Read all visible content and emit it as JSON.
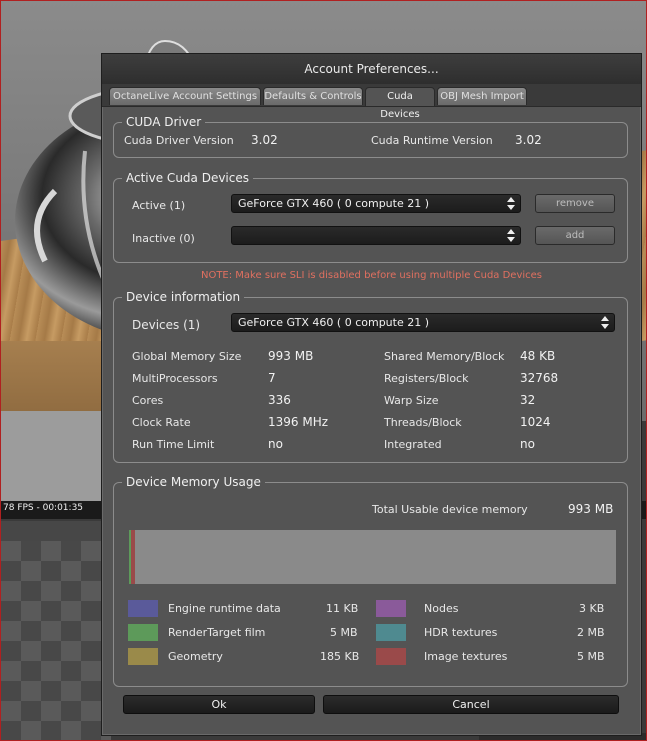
{
  "viewport": {
    "status": "78 FPS - 00:01:35"
  },
  "dialog": {
    "title": "Account Preferences...",
    "tabs": [
      {
        "label": "OctaneLive Account Settings"
      },
      {
        "label": "Defaults & Controls"
      },
      {
        "label": "Cuda Devices"
      },
      {
        "label": "OBJ Mesh Import"
      }
    ],
    "active_tab": "Cuda Devices"
  },
  "driver": {
    "legend": "CUDA Driver",
    "driver_version_label": "Cuda Driver Version",
    "driver_version": "3.02",
    "runtime_version_label": "Cuda Runtime Version",
    "runtime_version": "3.02"
  },
  "active_devices": {
    "legend": "Active Cuda Devices",
    "active_label": "Active (1)",
    "active_value": "GeForce GTX 460 ( 0 compute 21 )",
    "inactive_label": "Inactive (0)",
    "inactive_value": "",
    "remove_label": "remove",
    "add_label": "add"
  },
  "note": "NOTE: Make sure SLI is disabled before using multiple Cuda Devices",
  "device_info": {
    "legend": "Device information",
    "devices_label": "Devices (1)",
    "devices_value": "GeForce GTX 460 ( 0 compute 21 )",
    "left": [
      {
        "label": "Global Memory Size",
        "value": "993 MB"
      },
      {
        "label": "MultiProcessors",
        "value": "7"
      },
      {
        "label": "Cores",
        "value": "336"
      },
      {
        "label": "Clock Rate",
        "value": "1396 MHz"
      },
      {
        "label": "Run Time Limit",
        "value": "no"
      }
    ],
    "right": [
      {
        "label": "Shared Memory/Block",
        "value": "48 KB"
      },
      {
        "label": "Registers/Block",
        "value": "32768"
      },
      {
        "label": "Warp Size",
        "value": "32"
      },
      {
        "label": "Threads/Block",
        "value": "1024"
      },
      {
        "label": "Integrated",
        "value": "no"
      }
    ]
  },
  "memory": {
    "legend": "Device Memory Usage",
    "total_label": "Total Usable device memory",
    "total_value": "993 MB",
    "usage_fraction": 0.012,
    "items": [
      {
        "label": "Engine runtime data",
        "value": "11 KB",
        "color": "#5a5a9a"
      },
      {
        "label": "Nodes",
        "value": "3 KB",
        "color": "#8a5a9a"
      },
      {
        "label": "RenderTarget film",
        "value": "5 MB",
        "color": "#5d9a5a"
      },
      {
        "label": "HDR textures",
        "value": "2 MB",
        "color": "#4f8a90"
      },
      {
        "label": "Geometry",
        "value": "185 KB",
        "color": "#9a8a4a"
      },
      {
        "label": "Image textures",
        "value": "5 MB",
        "color": "#9a4a4a"
      }
    ]
  },
  "buttons": {
    "ok": "Ok",
    "cancel": "Cancel"
  },
  "colors": {
    "note": "#e07060",
    "dialog_bg": "#545454"
  }
}
